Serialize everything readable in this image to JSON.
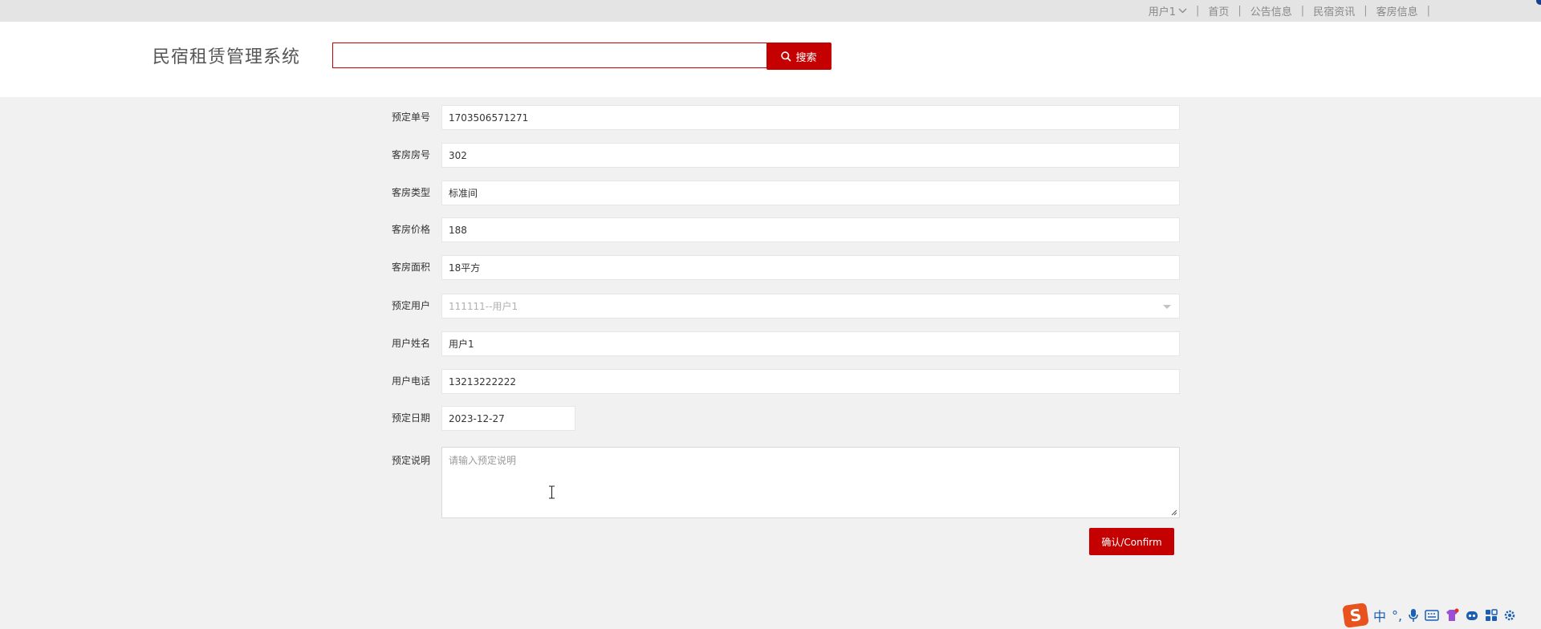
{
  "topnav": {
    "user_label": "用户1",
    "links": [
      "首页",
      "公告信息",
      "民宿资讯",
      "客房信息"
    ],
    "separator": "|"
  },
  "header": {
    "title": "民宿租赁管理系统",
    "search": {
      "value": "",
      "placeholder": "",
      "button_label": "搜索"
    }
  },
  "form": {
    "fields": [
      {
        "label": "预定单号",
        "value": "1703506571271"
      },
      {
        "label": "客房房号",
        "value": "302"
      },
      {
        "label": "客房类型",
        "value": "标准间"
      },
      {
        "label": "客房价格",
        "value": "188"
      },
      {
        "label": "客房面积",
        "value": "18平方"
      },
      {
        "label": "预定用户",
        "value": "111111--用户1",
        "disabled": true,
        "type": "select"
      },
      {
        "label": "用户姓名",
        "value": "用户1"
      },
      {
        "label": "用户电话",
        "value": "13213222222"
      },
      {
        "label": "预定日期",
        "value": "2023-12-27"
      }
    ],
    "remark": {
      "label": "预定说明",
      "placeholder": "请输入预定说明",
      "value": ""
    },
    "confirm_label": "确认/Confirm"
  },
  "ime": {
    "logo": "S",
    "mode": "中",
    "punct": "°,",
    "icons": [
      "microphone-icon",
      "keyboard-icon",
      "skin-icon",
      "robot-icon",
      "apps-icon",
      "settings-icon"
    ]
  },
  "colors": {
    "accent": "#c40000",
    "topbar_bg": "#e4e4e4",
    "page_bg": "#f1f1f1",
    "ime_blue": "#1a5fb4",
    "ime_logo": "#e8521f"
  }
}
